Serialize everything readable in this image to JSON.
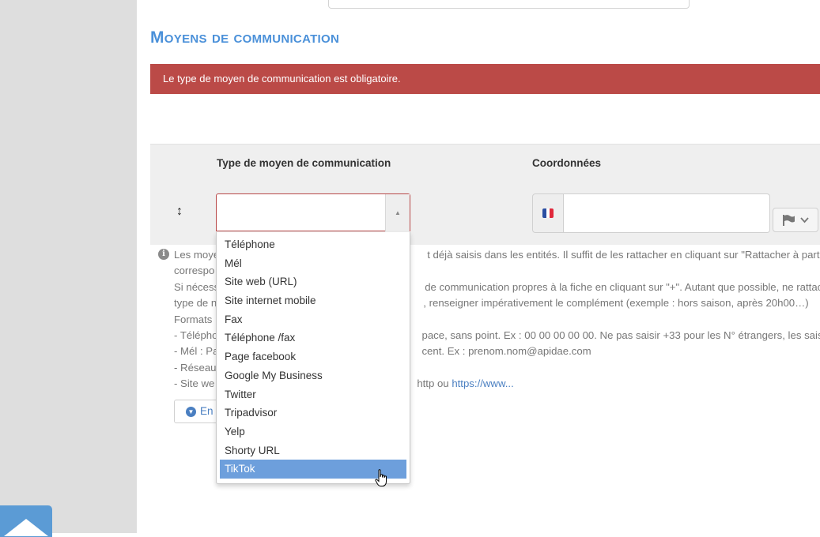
{
  "section": {
    "title": "Moyens de communication"
  },
  "alert": {
    "message": "Le type de moyen de communication est obligatoire."
  },
  "table": {
    "columns": {
      "type": "Type de moyen de communication",
      "coords": "Coordonnées"
    }
  },
  "dropdown": {
    "options": [
      "Téléphone",
      "Mél",
      "Site web (URL)",
      "Site internet mobile",
      "Fax",
      "Téléphone /fax",
      "Page facebook",
      "Google My Business",
      "Twitter",
      "Tripadvisor",
      "Yelp",
      "Shorty URL",
      "TikTok"
    ],
    "highlighted": "TikTok"
  },
  "help": {
    "l1a": "Les moye",
    "l1b": "t déjà saisis dans les entités. Il suffit de les rattacher en cliquant sur \"Rattacher à partir",
    "l2a": "correspo",
    "l3a": "Si nécess",
    "l3b": "de communication propres à la fiche en cliquant sur \"+\". Autant que possible, ne rattach",
    "l4a": "type de n",
    "l4b": ", renseigner impérativement le complément (exemple : hors saison, après 20h00…)",
    "l5a": "Formats",
    "l6a": "- Télépho",
    "l6b": "pace, sans point. Ex : 00 00 00 00 00. Ne pas saisir +33 pour les N° étrangers, les sais",
    "l7a": "- Mél : Pa",
    "l7b": "cent. Ex : prenom.nom@apidae.com",
    "l8a": "- Réseau",
    "l9a": "- Site we",
    "l9b": "http ou ",
    "l9link": "https://www..."
  },
  "expand_button": {
    "label": "En"
  },
  "colors": {
    "accent": "#4a90d9",
    "alert_bg": "#bb4a47",
    "highlight": "#6d9fdc"
  }
}
